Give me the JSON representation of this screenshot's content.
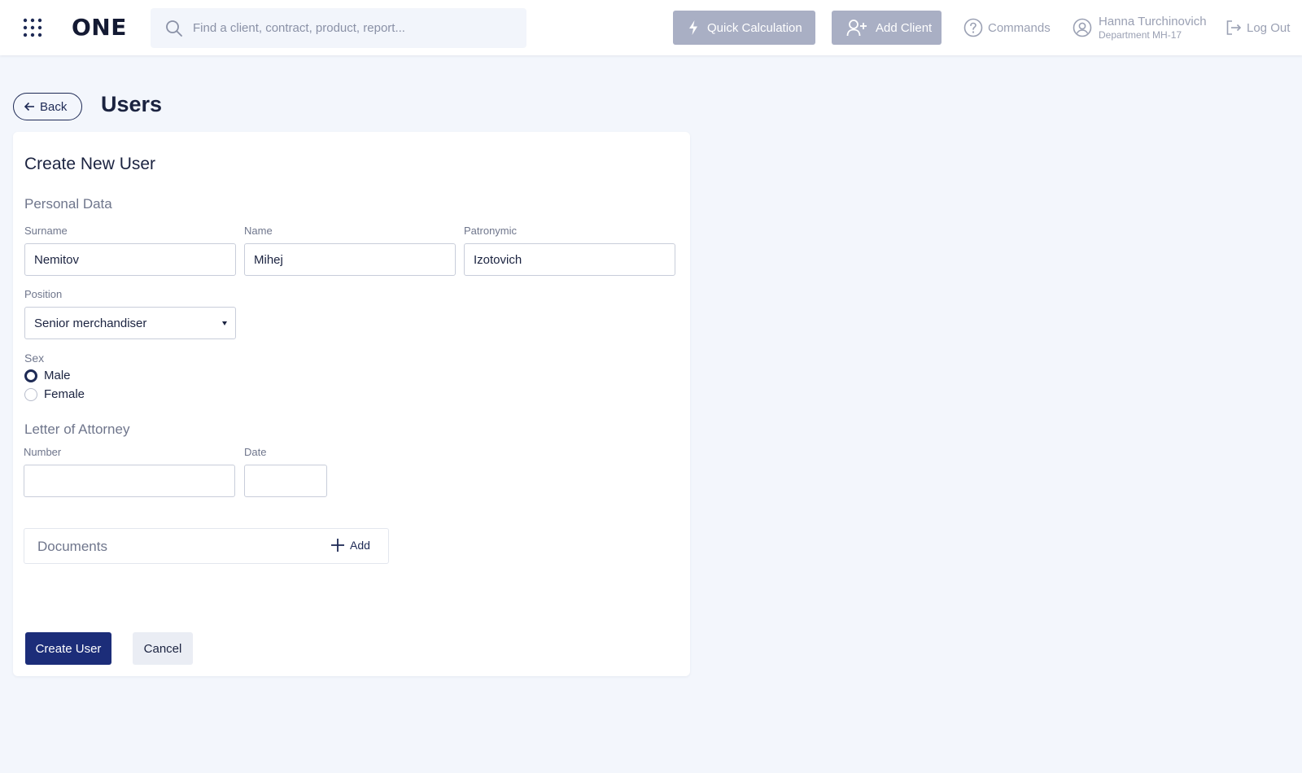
{
  "header": {
    "logo": "ONE",
    "search_placeholder": "Find a client, contract, product, report...",
    "quick_calc_label": "Quick Calculation",
    "add_client_label": "Add Client",
    "commands_label": "Commands",
    "user_name": "Hanna Turchinovich",
    "user_department": "Department MH-17",
    "logout_label": "Log Out",
    "icons": [
      "apps-grid-icon",
      "search-icon",
      "lightning-icon",
      "add-user-icon",
      "help-circle-icon",
      "user-avatar-icon",
      "logout-icon"
    ]
  },
  "page": {
    "back_label": "Back",
    "title": "Users"
  },
  "form": {
    "title": "Create New User",
    "personal_section": "Personal Data",
    "surname_label": "Surname",
    "surname_value": "Nemitov",
    "name_label": "Name",
    "name_value": "Mihej",
    "patronymic_label": "Patronymic",
    "patronymic_value": "Izotovich",
    "position_label": "Position",
    "position_value": "Senior merchandiser",
    "sex_label": "Sex",
    "sex_options": [
      "Male",
      "Female"
    ],
    "sex_selected": "Male",
    "attorney_section": "Letter of Attorney",
    "number_label": "Number",
    "number_value": "",
    "date_label": "Date",
    "date_value": "",
    "documents_label": "Documents",
    "documents_add_label": "Add",
    "create_button": "Create User",
    "cancel_button": "Cancel"
  },
  "colors": {
    "background": "#f3f6fc",
    "primary": "#1c2d79",
    "header_button_bg": "#a9afc4",
    "text_dark": "#1b2340",
    "text_muted": "#6f768c"
  }
}
